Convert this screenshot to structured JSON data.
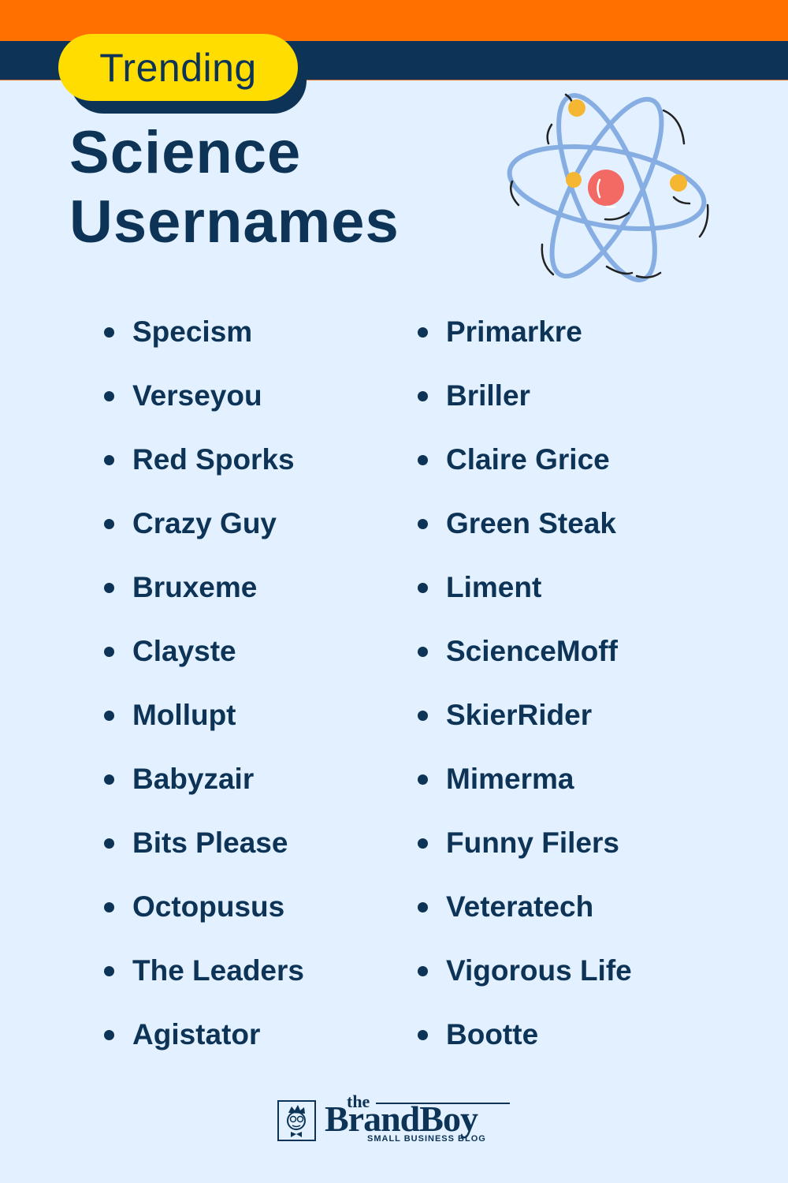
{
  "header": {
    "badge_label": "Trending",
    "title_line1": "Science",
    "title_line2": "Usernames",
    "colors": {
      "orange": "#ff7000",
      "navy": "#0d3456",
      "yellow": "#ffdd00",
      "background": "#e3f0ff"
    }
  },
  "illustration": {
    "icon": "atom-icon"
  },
  "usernames": {
    "left": [
      "Specism",
      "Verseyou",
      "Red Sporks",
      "Crazy Guy",
      "Bruxeme",
      "Clayste",
      "Mollupt",
      "Babyzair",
      "Bits Please",
      "Octopusus",
      "The Leaders",
      "Agistator"
    ],
    "right": [
      "Primarkre",
      "Briller",
      "Claire Grice",
      "Green Steak",
      "Liment",
      "ScienceMoff",
      "SkierRider",
      "Mimerma",
      "Funny Filers",
      "Veteratech",
      "Vigorous Life",
      "Bootte"
    ]
  },
  "footer": {
    "logo_the": "the",
    "logo_brand": "BrandBoy",
    "logo_tagline": "SMALL BUSINESS BLOG"
  }
}
